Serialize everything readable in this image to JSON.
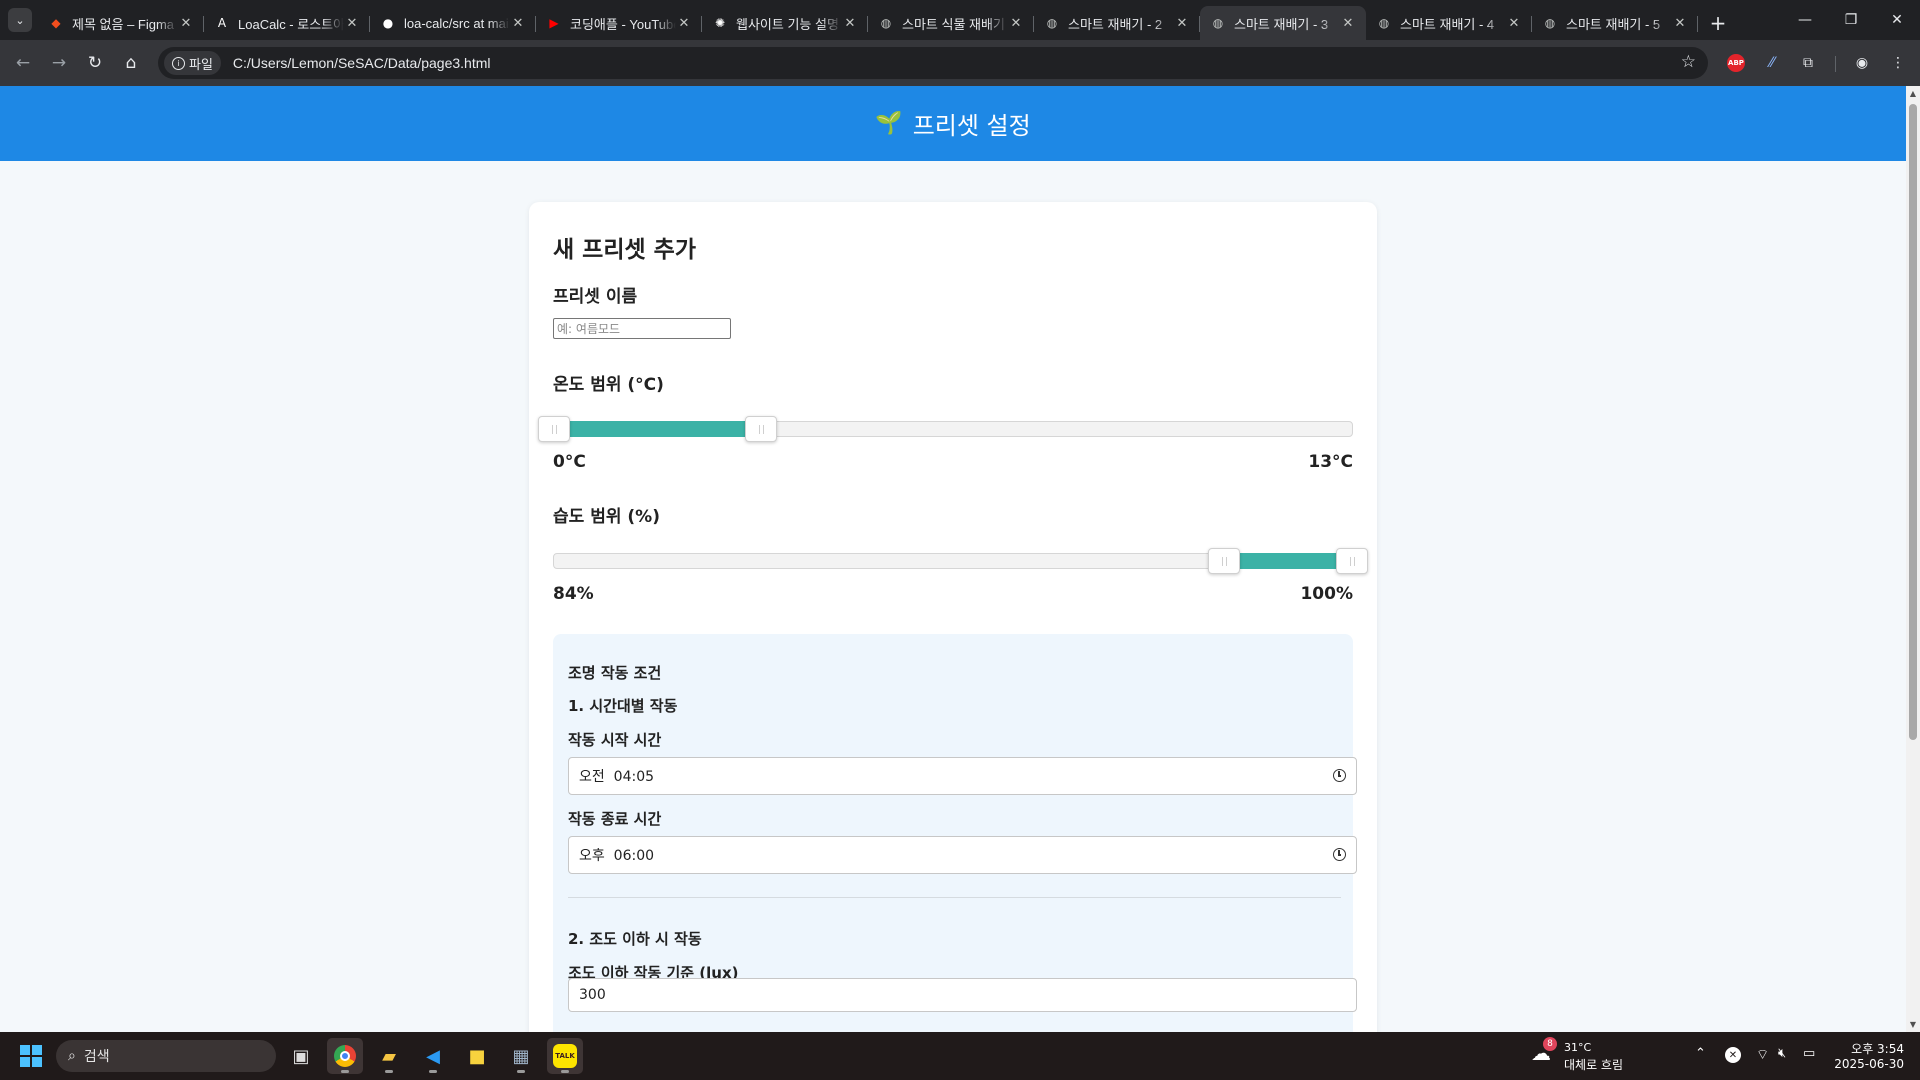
{
  "browser": {
    "tabs": [
      {
        "title": "제목 없음 – Figma",
        "icon": "figma-icon",
        "color": "#f24e1e"
      },
      {
        "title": "LoaCalc - 로스트아크",
        "icon": "loacalc-icon",
        "color": "#ffffff"
      },
      {
        "title": "loa-calc/src at main",
        "icon": "github-icon",
        "color": "#ffffff"
      },
      {
        "title": "코딩애플 - YouTube",
        "icon": "youtube-icon",
        "color": "#ff0000"
      },
      {
        "title": "웹사이트 기능 설명",
        "icon": "openai-icon",
        "color": "#ffffff"
      },
      {
        "title": "스마트 식물 재배기",
        "icon": "globe-icon",
        "color": "#c4c7c5"
      },
      {
        "title": "스마트 재배기 - 2",
        "icon": "globe-icon",
        "color": "#c4c7c5"
      },
      {
        "title": "스마트 재배기 - 3",
        "icon": "globe-icon",
        "color": "#c4c7c5",
        "active": true
      },
      {
        "title": "스마트 재배기 - 4",
        "icon": "globe-icon",
        "color": "#c4c7c5"
      },
      {
        "title": "스마트 재배기 - 5",
        "icon": "globe-icon",
        "color": "#c4c7c5"
      }
    ],
    "site_chip": "파일",
    "url": "C:/Users/Lemon/SeSAC/Data/page3.html"
  },
  "page": {
    "header_icon": "🌱",
    "header_title": "프리셋 설정",
    "card_title": "새 프리셋 추가",
    "name_label": "프리셋 이름",
    "name_placeholder": "예: 여름모드",
    "temp": {
      "label": "온도 범위 (°C)",
      "min_text": "0°C",
      "max_text": "13°C",
      "low_fraction": 0.0,
      "high_fraction": 0.26
    },
    "humidity": {
      "label": "습도 범위 (%)",
      "min_text": "84%",
      "max_text": "100%",
      "low_fraction": 0.84,
      "high_fraction": 1.0
    },
    "lighting": {
      "section_title": "조명 작동 조건",
      "mode1_title": "1. 시간대별 작동",
      "start_label": "작동 시작 시간",
      "start_value": "오전  04:05",
      "end_label": "작동 종료 시간",
      "end_value": "오후  06:00",
      "mode2_title": "2. 조도 이하 시 작동",
      "lux_label": "조도 이하 작동 기준 (lux)",
      "lux_value": "300"
    },
    "accent_color": "#3bb2a6",
    "header_color": "#1e88e5"
  },
  "taskbar": {
    "search_placeholder": "검색",
    "weather_badge": "8",
    "weather_temp": "31°C",
    "weather_desc": "대체로 흐림",
    "time": "오후 3:54",
    "date": "2025-06-30"
  }
}
